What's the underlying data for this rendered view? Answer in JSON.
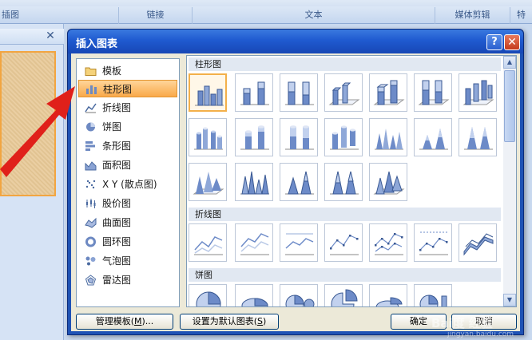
{
  "ribbon": {
    "groups": [
      {
        "label": "插图"
      },
      {
        "label": "链接"
      },
      {
        "label": "文本"
      },
      {
        "label": "媒体剪辑"
      },
      {
        "label": "特"
      }
    ]
  },
  "dialog": {
    "title": "插入图表",
    "help_label": "?",
    "close_label": "✕",
    "categories": [
      {
        "label": "模板",
        "icon": "folder-icon"
      },
      {
        "label": "柱形图",
        "icon": "column-chart-icon",
        "selected": true
      },
      {
        "label": "折线图",
        "icon": "line-chart-icon"
      },
      {
        "label": "饼图",
        "icon": "pie-chart-icon"
      },
      {
        "label": "条形图",
        "icon": "bar-chart-icon"
      },
      {
        "label": "面积图",
        "icon": "area-chart-icon"
      },
      {
        "label": "X Y (散点图)",
        "icon": "scatter-chart-icon"
      },
      {
        "label": "股价图",
        "icon": "stock-chart-icon"
      },
      {
        "label": "曲面图",
        "icon": "surface-chart-icon"
      },
      {
        "label": "圆环图",
        "icon": "doughnut-chart-icon"
      },
      {
        "label": "气泡图",
        "icon": "bubble-chart-icon"
      },
      {
        "label": "雷达图",
        "icon": "radar-chart-icon"
      }
    ],
    "sections": [
      {
        "label": "柱形图"
      },
      {
        "label": "折线图"
      },
      {
        "label": "饼图"
      }
    ],
    "buttons": {
      "manage": "管理模板(M)...",
      "manage_pre": "管理模板(",
      "manage_key": "M",
      "manage_post": ")...",
      "set_default_pre": "设置为默认图表(",
      "set_default_key": "S",
      "set_default_post": ")",
      "ok": "确定",
      "cancel": "取消"
    }
  },
  "watermark": {
    "brand": "Bai度 经验",
    "url": "jingyan.baidu.com"
  }
}
